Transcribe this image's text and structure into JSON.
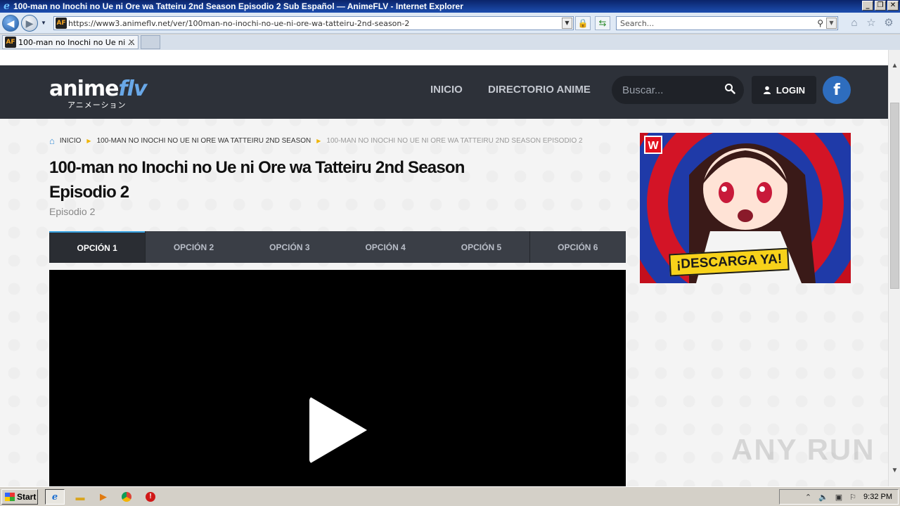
{
  "window": {
    "title": "100-man no Inochi no Ue ni Ore wa Tatteiru 2nd Season Episodio 2 Sub Español — AnimeFLV - Internet Explorer"
  },
  "browser": {
    "address": "https://www3.animeflv.net/ver/100man-no-inochi-no-ue-ni-ore-wa-tatteiru-2nd-season-2",
    "search_placeholder": "Search...",
    "favicon_text": "AF",
    "tab_label": "100-man no Inochi no Ue ni ..."
  },
  "site": {
    "logo_main": "anime",
    "logo_accent": "flv",
    "logo_sub": "アニメーション",
    "nav": [
      "INICIO",
      "DIRECTORIO ANIME"
    ],
    "search_placeholder": "Buscar...",
    "login_label": "LOGIN",
    "facebook_label": "f"
  },
  "breadcrumb": {
    "home": "INICIO",
    "series": "100-MAN NO INOCHI NO UE NI ORE WA TATTEIRU 2ND SEASON",
    "current": "100-MAN NO INOCHI NO UE NI ORE WA TATTEIRU 2ND SEASON EPISODIO 2"
  },
  "episode": {
    "title": "100-man no Inochi no Ue ni Ore wa Tatteiru 2nd Season Episodio 2",
    "subtitle": "Episodio 2",
    "options": [
      "OPCIÓN 1",
      "OPCIÓN 2",
      "OPCIÓN 3",
      "OPCIÓN 4",
      "OPCIÓN 5",
      "OPCIÓN 6"
    ],
    "active_option": 0
  },
  "ad": {
    "logo": "W",
    "cta": "¡DESCARGA YA!"
  },
  "watermark": "ANY RUN",
  "taskbar": {
    "start": "Start",
    "clock": "9:32 PM"
  },
  "colors": {
    "header_bg": "#2d3139",
    "accent_blue": "#35a0e0",
    "breadcrumb_sep": "#f0b400",
    "ad_red": "#c40f1d",
    "ad_yellow": "#f7d21a"
  }
}
